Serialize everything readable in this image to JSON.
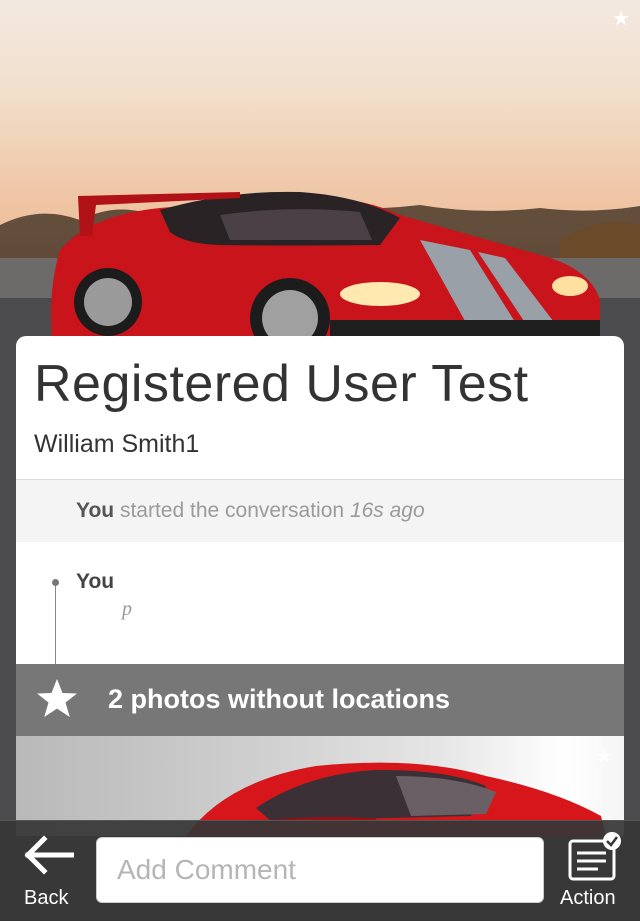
{
  "hero": {
    "favorite_icon": "star-icon"
  },
  "conversation": {
    "title": "Registered User Test",
    "participant": "William Smith1",
    "system_event": {
      "actor": "You",
      "action": "started the conversation",
      "time_ago": "16s ago"
    },
    "comments": [
      {
        "author": "You",
        "text": "p"
      }
    ],
    "photos_notice": {
      "icon": "star-icon",
      "label": "2 photos without locations"
    }
  },
  "toolbar": {
    "back_label": "Back",
    "back_icon": "arrow-left-icon",
    "comment_placeholder": "Add Comment",
    "comment_value": "",
    "action_label": "Action",
    "action_icon": "compose-check-icon"
  },
  "colors": {
    "car_red": "#d6161a",
    "notice_bar": "#777777",
    "toolbar_bg": "#373737"
  }
}
